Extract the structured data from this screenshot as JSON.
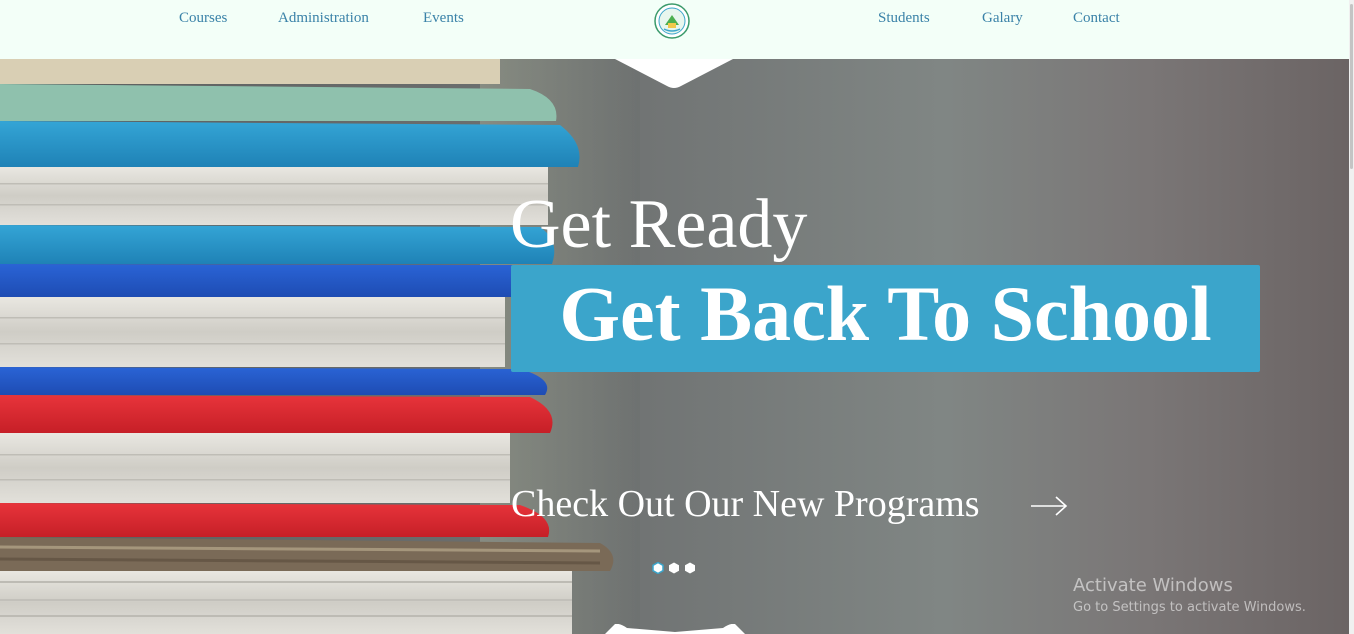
{
  "nav": {
    "left_items": [
      {
        "label": "Courses"
      },
      {
        "label": "Administration"
      },
      {
        "label": "Events"
      }
    ],
    "right_items": [
      {
        "label": "Students"
      },
      {
        "label": "Galary"
      },
      {
        "label": "Contact"
      }
    ],
    "logo_icon": "school-crest-logo"
  },
  "hero": {
    "headline_small": "Get Ready",
    "headline_large": "Get Back To School",
    "cta_label": "Check Out Our New Programs",
    "cta_icon": "arrow-right-icon",
    "slide_indicators": [
      {
        "active": true
      },
      {
        "active": false
      },
      {
        "active": false
      }
    ],
    "accent_color": "#3ba5cb"
  },
  "watermark": {
    "title": "Activate Windows",
    "subtitle": "Go to Settings to activate Windows."
  },
  "colors": {
    "nav_background": "#f3fff8",
    "nav_link": "#3a82a8",
    "highlight_box": "#3ba5cb"
  }
}
